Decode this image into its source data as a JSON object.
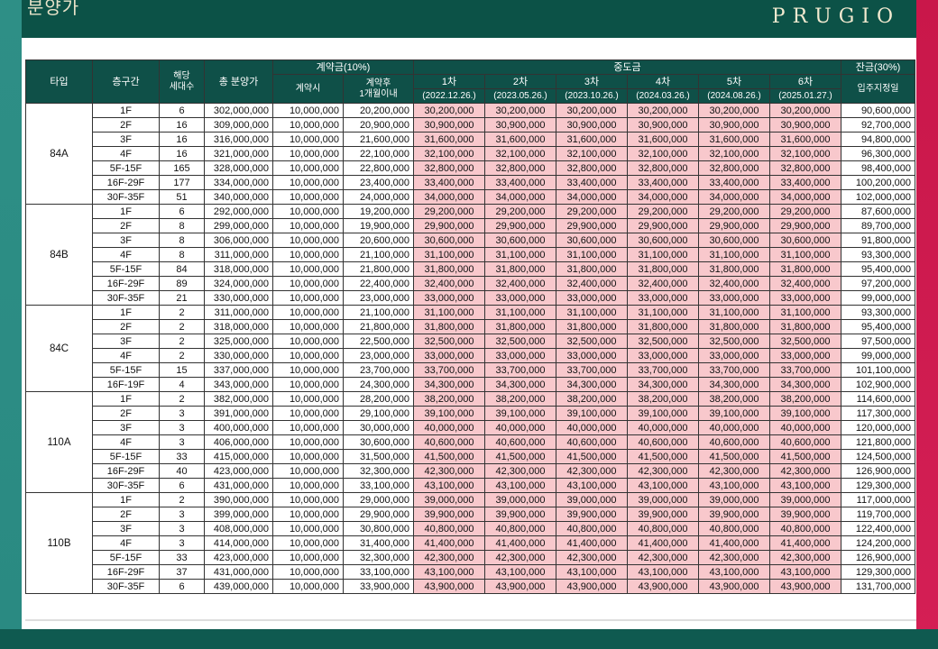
{
  "header": {
    "title": "분양가",
    "brand": "PRUGIO"
  },
  "table": {
    "headers": {
      "type": "타입",
      "floor": "층구간",
      "units": "해당\n세대수",
      "total": "총 분양가",
      "deposit_group": "계약금(10%)",
      "deposit_on_signing": "계약시",
      "deposit_after": "계약후\n1개월이내",
      "middle_group": "중도금",
      "balance_group": "잔금(30%)",
      "balance_sub": "입주지정일",
      "installments": [
        {
          "label": "1차",
          "date": "(2022.12.26.)"
        },
        {
          "label": "2차",
          "date": "(2023.05.26.)"
        },
        {
          "label": "3차",
          "date": "(2023.10.26.)"
        },
        {
          "label": "4차",
          "date": "(2024.03.26.)"
        },
        {
          "label": "5차",
          "date": "(2024.08.26.)"
        },
        {
          "label": "6차",
          "date": "(2025.01.27.)"
        }
      ]
    },
    "groups": [
      {
        "type": "84A",
        "rows": [
          {
            "floor": "1F",
            "units": "6",
            "total": "302,000,000",
            "d1": "10,000,000",
            "d2": "20,200,000",
            "mid": "30,200,000",
            "bal": "90,600,000"
          },
          {
            "floor": "2F",
            "units": "16",
            "total": "309,000,000",
            "d1": "10,000,000",
            "d2": "20,900,000",
            "mid": "30,900,000",
            "bal": "92,700,000"
          },
          {
            "floor": "3F",
            "units": "16",
            "total": "316,000,000",
            "d1": "10,000,000",
            "d2": "21,600,000",
            "mid": "31,600,000",
            "bal": "94,800,000"
          },
          {
            "floor": "4F",
            "units": "16",
            "total": "321,000,000",
            "d1": "10,000,000",
            "d2": "22,100,000",
            "mid": "32,100,000",
            "bal": "96,300,000"
          },
          {
            "floor": "5F-15F",
            "units": "165",
            "total": "328,000,000",
            "d1": "10,000,000",
            "d2": "22,800,000",
            "mid": "32,800,000",
            "bal": "98,400,000"
          },
          {
            "floor": "16F-29F",
            "units": "177",
            "total": "334,000,000",
            "d1": "10,000,000",
            "d2": "23,400,000",
            "mid": "33,400,000",
            "bal": "100,200,000"
          },
          {
            "floor": "30F-35F",
            "units": "51",
            "total": "340,000,000",
            "d1": "10,000,000",
            "d2": "24,000,000",
            "mid": "34,000,000",
            "bal": "102,000,000"
          }
        ]
      },
      {
        "type": "84B",
        "rows": [
          {
            "floor": "1F",
            "units": "6",
            "total": "292,000,000",
            "d1": "10,000,000",
            "d2": "19,200,000",
            "mid": "29,200,000",
            "bal": "87,600,000"
          },
          {
            "floor": "2F",
            "units": "8",
            "total": "299,000,000",
            "d1": "10,000,000",
            "d2": "19,900,000",
            "mid": "29,900,000",
            "bal": "89,700,000"
          },
          {
            "floor": "3F",
            "units": "8",
            "total": "306,000,000",
            "d1": "10,000,000",
            "d2": "20,600,000",
            "mid": "30,600,000",
            "bal": "91,800,000"
          },
          {
            "floor": "4F",
            "units": "8",
            "total": "311,000,000",
            "d1": "10,000,000",
            "d2": "21,100,000",
            "mid": "31,100,000",
            "bal": "93,300,000"
          },
          {
            "floor": "5F-15F",
            "units": "84",
            "total": "318,000,000",
            "d1": "10,000,000",
            "d2": "21,800,000",
            "mid": "31,800,000",
            "bal": "95,400,000"
          },
          {
            "floor": "16F-29F",
            "units": "89",
            "total": "324,000,000",
            "d1": "10,000,000",
            "d2": "22,400,000",
            "mid": "32,400,000",
            "bal": "97,200,000"
          },
          {
            "floor": "30F-35F",
            "units": "21",
            "total": "330,000,000",
            "d1": "10,000,000",
            "d2": "23,000,000",
            "mid": "33,000,000",
            "bal": "99,000,000"
          }
        ]
      },
      {
        "type": "84C",
        "rows": [
          {
            "floor": "1F",
            "units": "2",
            "total": "311,000,000",
            "d1": "10,000,000",
            "d2": "21,100,000",
            "mid": "31,100,000",
            "bal": "93,300,000"
          },
          {
            "floor": "2F",
            "units": "2",
            "total": "318,000,000",
            "d1": "10,000,000",
            "d2": "21,800,000",
            "mid": "31,800,000",
            "bal": "95,400,000"
          },
          {
            "floor": "3F",
            "units": "2",
            "total": "325,000,000",
            "d1": "10,000,000",
            "d2": "22,500,000",
            "mid": "32,500,000",
            "bal": "97,500,000"
          },
          {
            "floor": "4F",
            "units": "2",
            "total": "330,000,000",
            "d1": "10,000,000",
            "d2": "23,000,000",
            "mid": "33,000,000",
            "bal": "99,000,000"
          },
          {
            "floor": "5F-15F",
            "units": "15",
            "total": "337,000,000",
            "d1": "10,000,000",
            "d2": "23,700,000",
            "mid": "33,700,000",
            "bal": "101,100,000"
          },
          {
            "floor": "16F-19F",
            "units": "4",
            "total": "343,000,000",
            "d1": "10,000,000",
            "d2": "24,300,000",
            "mid": "34,300,000",
            "bal": "102,900,000"
          }
        ]
      },
      {
        "type": "110A",
        "rows": [
          {
            "floor": "1F",
            "units": "2",
            "total": "382,000,000",
            "d1": "10,000,000",
            "d2": "28,200,000",
            "mid": "38,200,000",
            "bal": "114,600,000"
          },
          {
            "floor": "2F",
            "units": "3",
            "total": "391,000,000",
            "d1": "10,000,000",
            "d2": "29,100,000",
            "mid": "39,100,000",
            "bal": "117,300,000"
          },
          {
            "floor": "3F",
            "units": "3",
            "total": "400,000,000",
            "d1": "10,000,000",
            "d2": "30,000,000",
            "mid": "40,000,000",
            "bal": "120,000,000"
          },
          {
            "floor": "4F",
            "units": "3",
            "total": "406,000,000",
            "d1": "10,000,000",
            "d2": "30,600,000",
            "mid": "40,600,000",
            "bal": "121,800,000"
          },
          {
            "floor": "5F-15F",
            "units": "33",
            "total": "415,000,000",
            "d1": "10,000,000",
            "d2": "31,500,000",
            "mid": "41,500,000",
            "bal": "124,500,000"
          },
          {
            "floor": "16F-29F",
            "units": "40",
            "total": "423,000,000",
            "d1": "10,000,000",
            "d2": "32,300,000",
            "mid": "42,300,000",
            "bal": "126,900,000"
          },
          {
            "floor": "30F-35F",
            "units": "6",
            "total": "431,000,000",
            "d1": "10,000,000",
            "d2": "33,100,000",
            "mid": "43,100,000",
            "bal": "129,300,000"
          }
        ]
      },
      {
        "type": "110B",
        "rows": [
          {
            "floor": "1F",
            "units": "2",
            "total": "390,000,000",
            "d1": "10,000,000",
            "d2": "29,000,000",
            "mid": "39,000,000",
            "bal": "117,000,000"
          },
          {
            "floor": "2F",
            "units": "3",
            "total": "399,000,000",
            "d1": "10,000,000",
            "d2": "29,900,000",
            "mid": "39,900,000",
            "bal": "119,700,000"
          },
          {
            "floor": "3F",
            "units": "3",
            "total": "408,000,000",
            "d1": "10,000,000",
            "d2": "30,800,000",
            "mid": "40,800,000",
            "bal": "122,400,000"
          },
          {
            "floor": "4F",
            "units": "3",
            "total": "414,000,000",
            "d1": "10,000,000",
            "d2": "31,400,000",
            "mid": "41,400,000",
            "bal": "124,200,000"
          },
          {
            "floor": "5F-15F",
            "units": "33",
            "total": "423,000,000",
            "d1": "10,000,000",
            "d2": "32,300,000",
            "mid": "42,300,000",
            "bal": "126,900,000"
          },
          {
            "floor": "16F-29F",
            "units": "37",
            "total": "431,000,000",
            "d1": "10,000,000",
            "d2": "33,100,000",
            "mid": "43,100,000",
            "bal": "129,300,000"
          },
          {
            "floor": "30F-35F",
            "units": "6",
            "total": "439,000,000",
            "d1": "10,000,000",
            "d2": "33,900,000",
            "mid": "43,900,000",
            "bal": "131,700,000"
          }
        ]
      }
    ]
  },
  "colors": {
    "header_bg": "#0f5048",
    "installment_bg": "#f8c8cc",
    "frame_left": "#2e8f86",
    "frame_right": "#d41f55"
  }
}
